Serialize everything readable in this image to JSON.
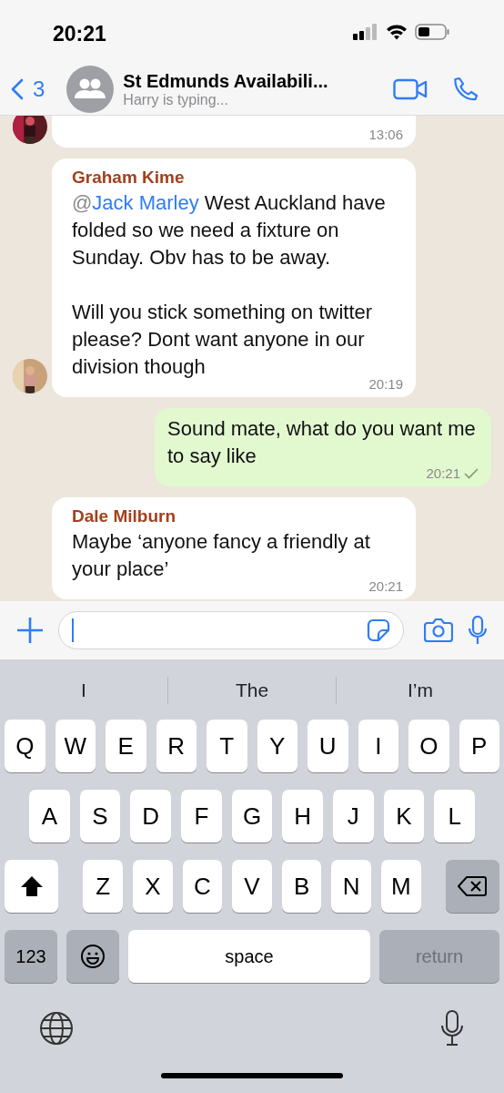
{
  "status_bar": {
    "time": "20:21"
  },
  "header": {
    "back_count": "3",
    "title": "St Edmunds Availabili...",
    "subtitle": "Harry is typing..."
  },
  "messages": [
    {
      "kind": "incoming",
      "avatar": true,
      "time": "13:06"
    },
    {
      "kind": "incoming",
      "avatar": true,
      "sender": "Graham Kime",
      "mention_prefix": "@",
      "mention": "Jack Marley",
      "text": "West Auckland have folded so we need a fixture on Sunday. Obv has to be away.\n\nWill you stick something on twitter please? Dont want anyone in our division though",
      "time": "20:19"
    },
    {
      "kind": "outgoing",
      "text": "Sound mate, what do you want me to say like",
      "time": "20:21",
      "sent": true
    },
    {
      "kind": "incoming",
      "avatar": false,
      "sender": "Dale Milburn",
      "text": "Maybe ‘anyone fancy a friendly at your place’",
      "time": "20:21"
    }
  ],
  "suggestions": [
    "I",
    "The",
    "I’m"
  ],
  "keyboard": {
    "rows": [
      {
        "keys": [
          {
            "kind": "letter",
            "label": "Q"
          },
          {
            "kind": "letter",
            "label": "W"
          },
          {
            "kind": "letter",
            "label": "E"
          },
          {
            "kind": "letter",
            "label": "R"
          },
          {
            "kind": "letter",
            "label": "T"
          },
          {
            "kind": "letter",
            "label": "Y"
          },
          {
            "kind": "letter",
            "label": "U"
          },
          {
            "kind": "letter",
            "label": "I"
          },
          {
            "kind": "letter",
            "label": "O"
          },
          {
            "kind": "letter",
            "label": "P"
          }
        ]
      },
      {
        "keys": [
          {
            "kind": "letter",
            "label": "A"
          },
          {
            "kind": "letter",
            "label": "S"
          },
          {
            "kind": "letter",
            "label": "D"
          },
          {
            "kind": "letter",
            "label": "F"
          },
          {
            "kind": "letter",
            "label": "G"
          },
          {
            "kind": "letter",
            "label": "H"
          },
          {
            "kind": "letter",
            "label": "J"
          },
          {
            "kind": "letter",
            "label": "K"
          },
          {
            "kind": "letter",
            "label": "L"
          }
        ]
      },
      {
        "keys": [
          {
            "kind": "shift"
          },
          {
            "kind": "letter",
            "label": "Z"
          },
          {
            "kind": "letter",
            "label": "X"
          },
          {
            "kind": "letter",
            "label": "C"
          },
          {
            "kind": "letter",
            "label": "V"
          },
          {
            "kind": "letter",
            "label": "B"
          },
          {
            "kind": "letter",
            "label": "N"
          },
          {
            "kind": "letter",
            "label": "M"
          },
          {
            "kind": "delete"
          }
        ]
      },
      {
        "keys": [
          {
            "kind": "numbers",
            "label": "123"
          },
          {
            "kind": "emoji"
          },
          {
            "kind": "space",
            "label": "space"
          },
          {
            "kind": "return",
            "label": "return",
            "disabled": true
          }
        ]
      }
    ]
  }
}
